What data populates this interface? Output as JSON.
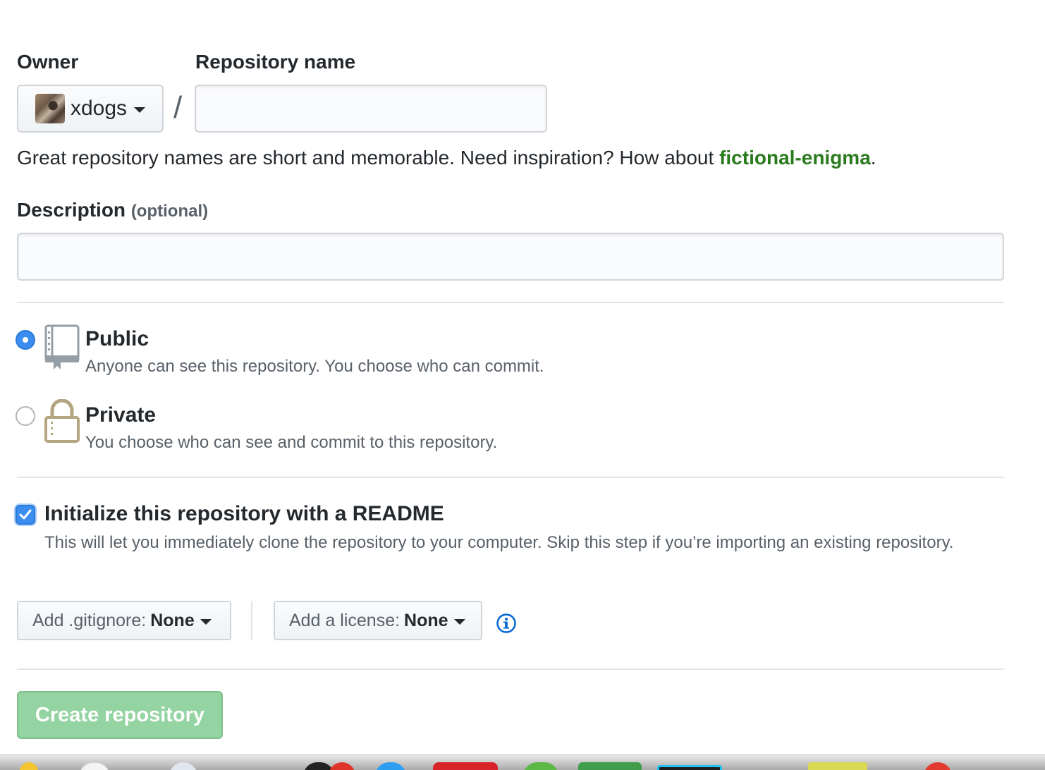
{
  "owner": {
    "label": "Owner",
    "selected": "xdogs"
  },
  "repository": {
    "label": "Repository name",
    "value": "",
    "separator": "/"
  },
  "hint": {
    "prefix": "Great repository names are short and memorable. Need inspiration? How about ",
    "suggestion": "fictional-enigma",
    "suffix": "."
  },
  "description": {
    "label": "Description",
    "optional": "(optional)",
    "value": ""
  },
  "visibility": {
    "public": {
      "title": "Public",
      "description": "Anyone can see this repository. You choose who can commit.",
      "checked": true
    },
    "private": {
      "title": "Private",
      "description": "You choose who can see and commit to this repository.",
      "checked": false
    }
  },
  "readme": {
    "title": "Initialize this repository with a README",
    "description": "This will let you immediately clone the repository to your computer. Skip this step if you’re importing an existing repository.",
    "checked": true
  },
  "gitignore": {
    "label": "Add .gitignore:",
    "value": "None"
  },
  "license": {
    "label": "Add a license:",
    "value": "None"
  },
  "create_button": "Create repository",
  "colors": {
    "accent_blue": "#3b8ef0",
    "suggestion_green": "#2a7a1e",
    "create_button_green": "#94d3a2",
    "info_icon_blue": "#0366d6"
  },
  "icons": {
    "public": "repo-book-icon",
    "private": "lock-icon",
    "info": "info-icon",
    "checkmark": "checkmark-icon"
  }
}
